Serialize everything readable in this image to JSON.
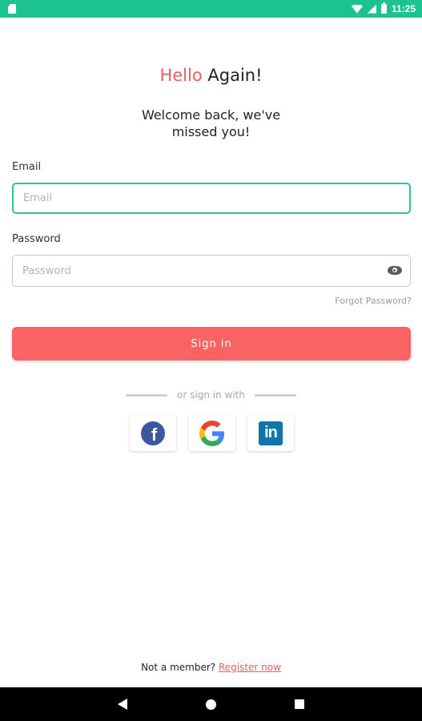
{
  "status_bar": {
    "time": "11:25",
    "icons": [
      "sim-card-icon",
      "wifi-icon",
      "signal-icon",
      "battery-icon"
    ],
    "background_color": "#1cc28f"
  },
  "header": {
    "title_accent": "Hello",
    "title_rest": " Again!",
    "subtitle_line1": "Welcome back, we've",
    "subtitle_line2": "missed you!"
  },
  "form": {
    "email_label": "Email",
    "email_placeholder": "Email",
    "email_value": "",
    "password_label": "Password",
    "password_placeholder": "Password",
    "password_value": "",
    "password_toggle_icon": "eye-icon",
    "forgot_password": "Forgot Password?",
    "sign_in_label": "Sign in"
  },
  "social": {
    "divider_text": "or sign in with",
    "providers": [
      {
        "name": "facebook",
        "icon": "facebook-icon",
        "glyph": "f"
      },
      {
        "name": "google",
        "icon": "google-icon"
      },
      {
        "name": "linkedin",
        "icon": "linkedin-icon",
        "glyph": "in"
      }
    ]
  },
  "footer": {
    "prompt": "Not a member? ",
    "register_link": "Register now"
  },
  "colors": {
    "accent": "#f25d5d",
    "button": "#fa6363",
    "focus_border": "#2fc497",
    "facebook": "#3b579d",
    "linkedin": "#0e76a8"
  },
  "nav_bar": {
    "icons": [
      "back-icon",
      "home-icon",
      "recents-icon"
    ]
  }
}
